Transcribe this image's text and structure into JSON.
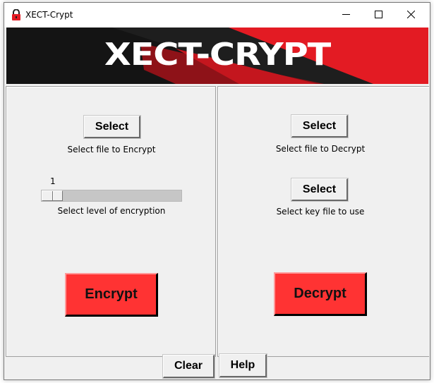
{
  "window": {
    "title": "XECT-Crypt",
    "icon": "padlock-icon",
    "controls": {
      "minimize": "minimize-icon",
      "maximize": "maximize-icon",
      "close": "close-icon"
    }
  },
  "banner": {
    "text": "XECT-CRYPT",
    "colors": {
      "dark": "#141414",
      "accent": "#e31b23"
    }
  },
  "encrypt_panel": {
    "select_button": "Select",
    "select_label": "Select file to Encrypt",
    "slider": {
      "value": "1",
      "fraction": 0.0,
      "label": "Select level of encryption"
    },
    "action_button": "Encrypt"
  },
  "decrypt_panel": {
    "select_button": "Select",
    "select_label": "Select file to Decrypt",
    "key_button": "Select",
    "key_label": "Select key file to use",
    "action_button": "Decrypt"
  },
  "footer": {
    "clear_button": "Clear",
    "help_button": "Help"
  },
  "colors": {
    "action_red": "#ff3333",
    "background": "#f0f0f0"
  }
}
